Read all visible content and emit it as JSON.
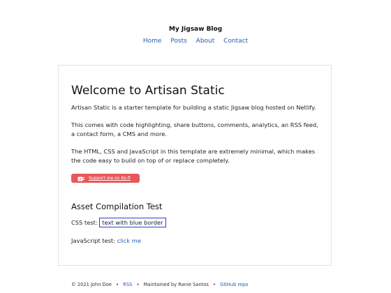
{
  "header": {
    "site_title": "My Jigsaw Blog",
    "nav": [
      "Home",
      "Posts",
      "About",
      "Contact"
    ]
  },
  "main": {
    "title": "Welcome to Artisan Static",
    "paragraphs": [
      "Artisan Static is a starter template for building a static Jigsaw blog hosted on Netlify.",
      "This comes with code highlighting, share buttons, comments, analytics, an RSS feed, a contact form, a CMS and more.",
      "The HTML, CSS and JavaScript in this template are extremely minimal, which makes the code easy to build on top of or replace completely."
    ],
    "kofi_label": "Support me on Ko-fi",
    "section_title": "Asset Compilation Test",
    "css_test_label": "CSS test:",
    "css_test_value": "text with blue border",
    "js_test_label": "JavaScript test:",
    "js_test_link": "click me"
  },
  "footer": {
    "copyright": "© 2021 John Doe",
    "rss": "RSS",
    "maintained": "Maintained by Ranie Santos",
    "github": "GitHub repo",
    "separator": "•"
  },
  "colors": {
    "link": "#2a5da8",
    "kofi": "#e8585b",
    "css_border": "#2b3be0"
  }
}
